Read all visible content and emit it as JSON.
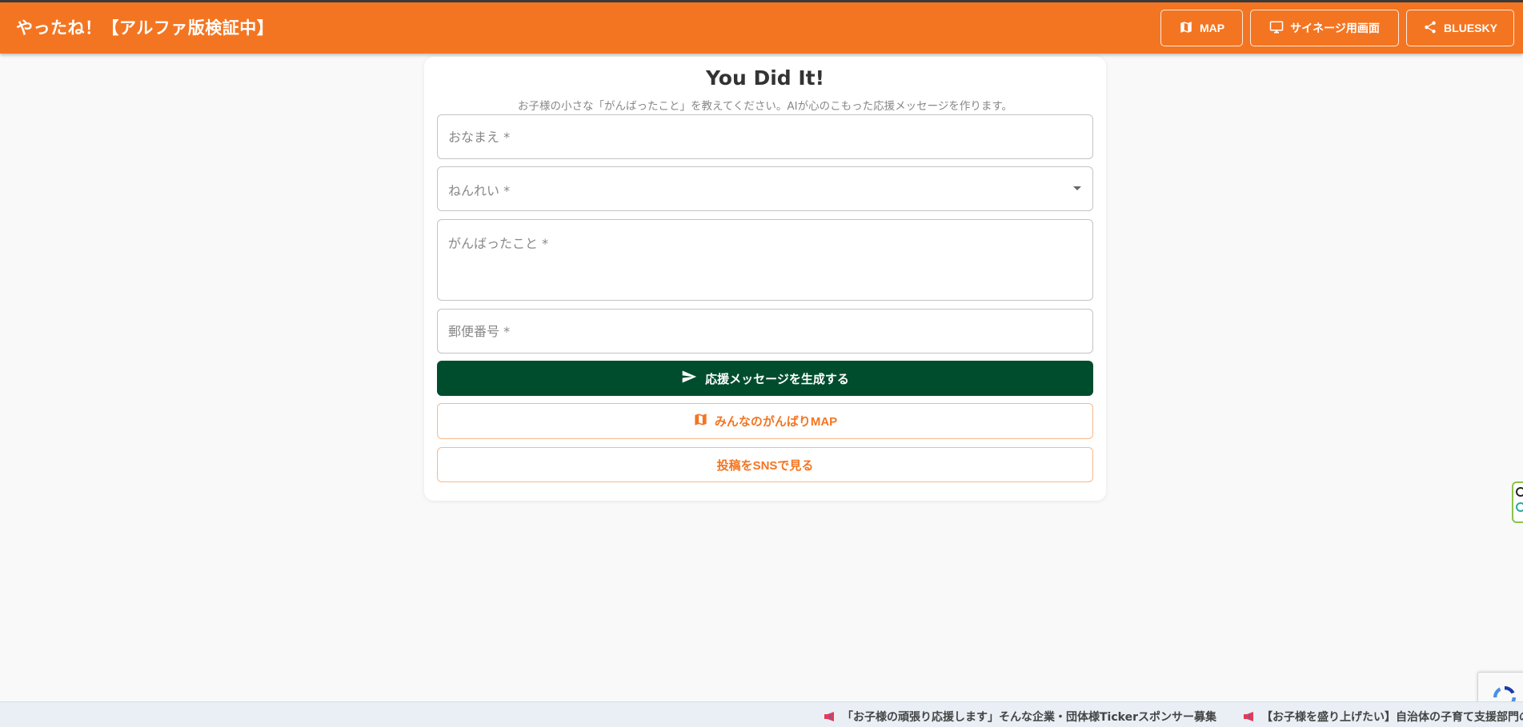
{
  "app": {
    "title": "やったね！【アルファ版検証中】",
    "accent_color": "#f47521",
    "primary_color": "#004d2e"
  },
  "header_nav": [
    {
      "label": "MAP",
      "icon": "map-icon"
    },
    {
      "label": "サイネージ用画面",
      "icon": "monitor-icon"
    },
    {
      "label": "BLUESKY",
      "icon": "share-icon"
    }
  ],
  "form": {
    "title": "You Did It!",
    "subtitle": "お子様の小さな「がんばったこと」を教えてください。AIが心のこもった応援メッセージを作ります。",
    "name_placeholder": "おなまえ *",
    "age_label": "ねんれい *",
    "effort_placeholder": "がんばったこと *",
    "zip_placeholder": "郵便番号 *",
    "submit_label": "応援メッセージを生成する",
    "map_label": "みんなのがんばりMAP",
    "sns_label": "投稿をSNSで見る"
  },
  "ticker": {
    "items": [
      "「お子様の頑張り応援します」そんな企業・団体様Tickerスポンサー募集",
      "【お子様を盛り上げたい】自治体の子育て支援部門の"
    ]
  }
}
